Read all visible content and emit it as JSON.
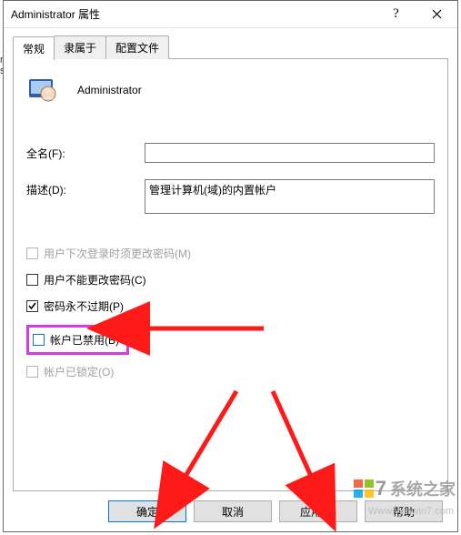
{
  "window": {
    "title": "Administrator 属性",
    "help_tooltip": "?",
    "account_name": "Administrator"
  },
  "tabs": {
    "t0": "常规",
    "t1": "隶属于",
    "t2": "配置文件"
  },
  "fields": {
    "fullname_label": "全名(F):",
    "fullname_value": "",
    "description_label": "描述(D):",
    "description_value": "管理计算机(域)的内置帐户"
  },
  "checks": {
    "must_change": "用户下次登录时须更改密码(M)",
    "cannot_change": "用户不能更改密码(C)",
    "never_expires": "密码永不过期(P)",
    "disabled": "帐户已禁用(B)",
    "locked": "帐户已锁定(O)"
  },
  "buttons": {
    "ok": "确定",
    "cancel": "取消",
    "apply": "应用(A)",
    "help": "帮助"
  },
  "watermark": {
    "seven": "7",
    "text": "系统之家",
    "url": "Www.Winwin7.com"
  }
}
